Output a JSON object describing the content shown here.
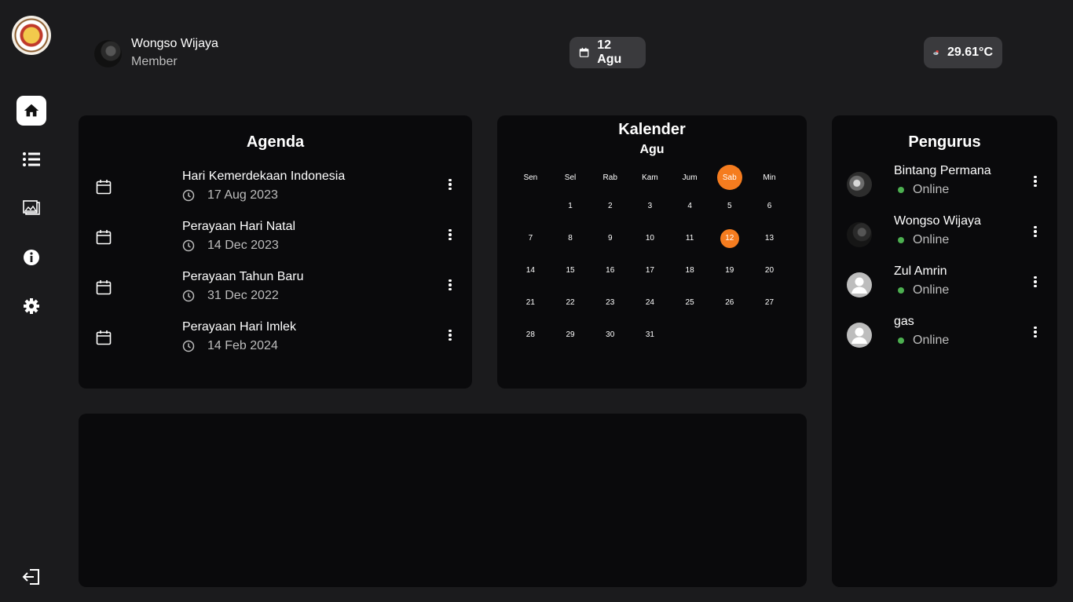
{
  "sidebar": {
    "items": [
      {
        "name": "home-icon",
        "active": true
      },
      {
        "name": "list-icon",
        "active": false
      },
      {
        "name": "gallery-icon",
        "active": false
      },
      {
        "name": "info-icon",
        "active": false
      },
      {
        "name": "settings-icon",
        "active": false
      }
    ],
    "logout": "logout-icon"
  },
  "profile": {
    "name": "Wongso Wijaya",
    "role": "Member"
  },
  "header": {
    "date": "12 Agu",
    "temperature": "29.61°C"
  },
  "agenda": {
    "title": "Agenda",
    "items": [
      {
        "title": "Hari Kemerdekaan Indonesia",
        "date": "17 Aug 2023"
      },
      {
        "title": "Perayaan Hari Natal",
        "date": "14 Dec 2023"
      },
      {
        "title": "Perayaan Tahun Baru",
        "date": "31 Dec 2022"
      },
      {
        "title": "Perayaan Hari Imlek",
        "date": "14 Feb 2024"
      }
    ]
  },
  "calendar": {
    "title": "Kalender",
    "month": "Agu",
    "weekdays": [
      "Sen",
      "Sel",
      "Rab",
      "Kam",
      "Jum",
      "Sab",
      "Min"
    ],
    "highlighted_weekday": "Sab",
    "first_weekday_offset": 1,
    "days_in_month": 31,
    "today": 12
  },
  "pengurus": {
    "title": "Pengurus",
    "members": [
      {
        "name": "Bintang Permana",
        "status": "Online",
        "avatar": "photo1"
      },
      {
        "name": "Wongso Wijaya",
        "status": "Online",
        "avatar": "photo2"
      },
      {
        "name": "Zul Amrin",
        "status": "Online",
        "avatar": "generic"
      },
      {
        "name": "gas",
        "status": "Online",
        "avatar": "generic"
      }
    ]
  },
  "colors": {
    "accent": "#f57c1f",
    "online": "#4caf50",
    "card": "#0a0a0c",
    "background": "#1b1b1d"
  }
}
